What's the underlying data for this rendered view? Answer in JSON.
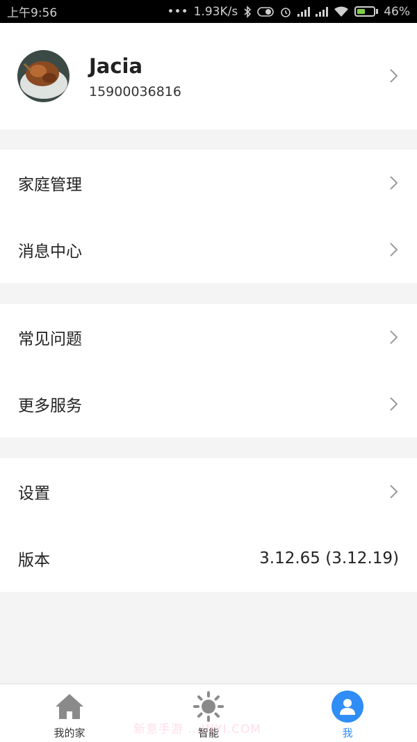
{
  "status_bar": {
    "time": "上午9:56",
    "dots": "•••",
    "speed": "1.93K/s",
    "battery": "46%"
  },
  "profile": {
    "name": "Jacia",
    "phone": "15900036816"
  },
  "menu": {
    "family": "家庭管理",
    "messages": "消息中心",
    "faq": "常见问题",
    "more_services": "更多服务",
    "settings": "设置",
    "version_label": "版本",
    "version_value": "3.12.65 (3.12.19)"
  },
  "nav": {
    "home": "我的家",
    "smart": "智能",
    "me": "我"
  },
  "watermark": "新意手游 ...INYI.COM",
  "colors": {
    "accent": "#2f8df5",
    "background": "#f4f4f4"
  }
}
